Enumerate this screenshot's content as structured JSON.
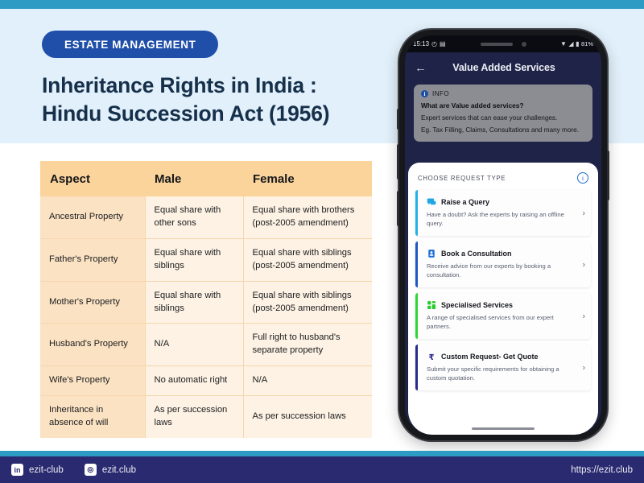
{
  "colors": {
    "accent_bar": "#2E9BC5",
    "hero_bg": "#E1F0FA",
    "badge_bg": "#1F4FA8",
    "title_text": "#16304B",
    "table_header_bg": "#FBD49B",
    "table_aspect_bg": "#FBE2C2",
    "table_cell_bg": "#FDF2E3",
    "footer_bg": "#2A2A70",
    "phone_app_bg": "#1E2347"
  },
  "hero": {
    "badge": "ESTATE MANAGEMENT",
    "title_line1": "Inheritance Rights in India :",
    "title_line2": "Hindu Succession Act (1956)"
  },
  "table": {
    "columns": [
      "Aspect",
      "Male",
      "Female"
    ],
    "rows": [
      {
        "aspect": "Ancestral Property",
        "male": "Equal share with other sons",
        "female": "Equal share with brothers (post-2005 amendment)"
      },
      {
        "aspect": "Father's Property",
        "male": "Equal share with siblings",
        "female": "Equal share with siblings (post-2005 amendment)"
      },
      {
        "aspect": "Mother's Property",
        "male": "Equal share with siblings",
        "female": "Equal share with siblings (post-2005 amendment)"
      },
      {
        "aspect": "Husband's Property",
        "male": "N/A",
        "female": "Full right to husband's separate property"
      },
      {
        "aspect": "Wife's Property",
        "male": "No automatic right",
        "female": "N/A"
      },
      {
        "aspect": "Inheritance in absence of will",
        "male": "As per succession laws",
        "female": "As per succession laws"
      }
    ]
  },
  "phone": {
    "status": {
      "time": "15:13",
      "left_icons": [
        "clock-icon",
        "sim-icon"
      ],
      "wifi": "wifi-icon",
      "signal": "signal-icon",
      "battery_icon": "battery-icon",
      "battery": "81%"
    },
    "app": {
      "back": "←",
      "title": "Value Added Services",
      "info": {
        "badge_glyph": "i",
        "label": "INFO",
        "question": "What are Value added services?",
        "line1": "Expert services that can ease your challenges.",
        "line2": "Eg. Tax Filling, Claims, Consultations and many more."
      },
      "sheet": {
        "heading": "CHOOSE REQUEST TYPE",
        "info_glyph": "i",
        "options": [
          {
            "title": "Raise a Query",
            "desc": "Have a doubt? Ask the experts by raising an offline query.",
            "stripe": "#22B0E8",
            "icon": "chat-icon",
            "icon_color": "#1FA7E3",
            "chevron": "›"
          },
          {
            "title": "Book a Consultation",
            "desc": "Receive advice from our experts by booking a consultation.",
            "stripe": "#1D58C4",
            "icon": "document-icon",
            "icon_color": "#1D6FD6",
            "chevron": "›"
          },
          {
            "title": "Specialised Services",
            "desc": "A range of specialised services from our expert partners.",
            "stripe": "#2ED733",
            "icon": "grid-icon",
            "icon_color": "#26CC2B",
            "chevron": "›"
          },
          {
            "title": "Custom Request- Get Quote",
            "desc": "Submit your specific requirements for obtaining a custom quotation.",
            "stripe": "#2A2A8C",
            "icon": "rupee-icon",
            "icon_color": "#24248A",
            "chevron": "›"
          }
        ]
      }
    }
  },
  "footer": {
    "socials": [
      {
        "icon": "linkedin-icon",
        "glyph": "in",
        "handle": "ezit-club"
      },
      {
        "icon": "instagram-icon",
        "glyph": "◎",
        "handle": "ezit.club"
      }
    ],
    "url": "https://ezit.club"
  }
}
